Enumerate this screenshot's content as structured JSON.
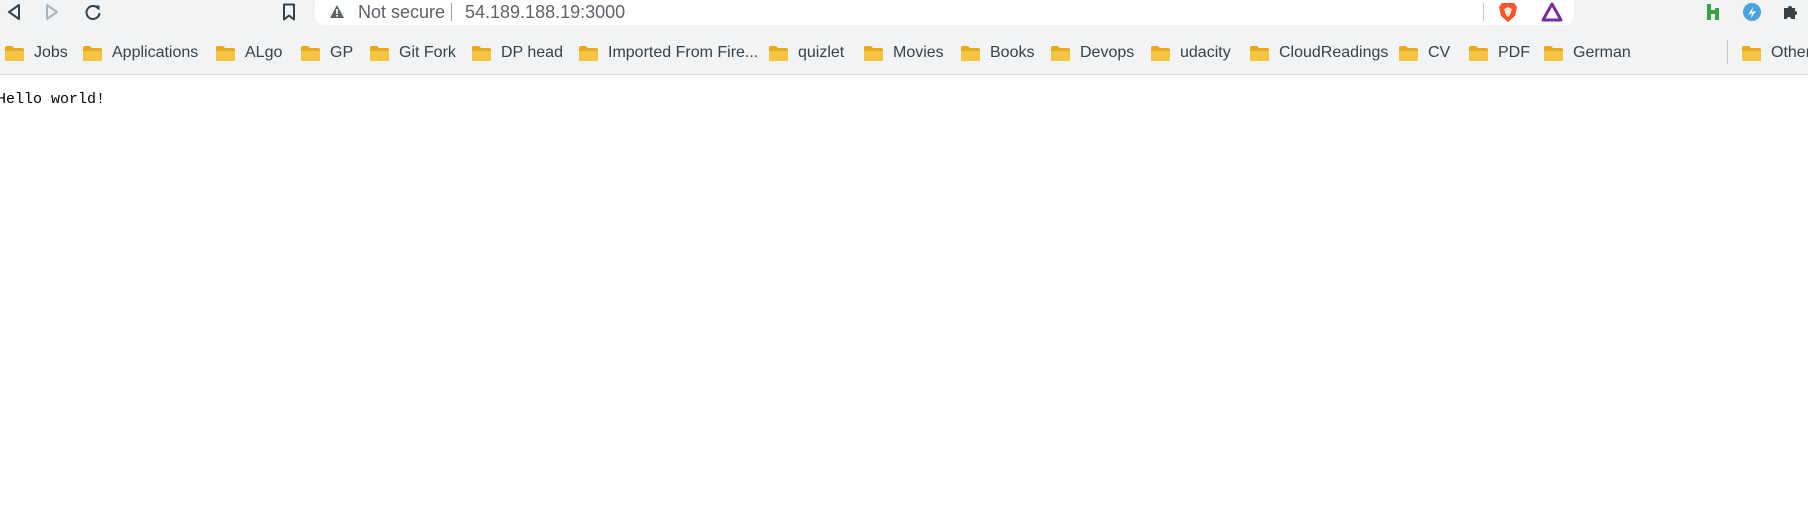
{
  "omnibox": {
    "security_status": "Not secure",
    "url": "54.189.188.19:3000"
  },
  "toolbar": {
    "icons": [
      "back-icon",
      "forward-icon",
      "reload-icon",
      "bookmark-icon",
      "warning-icon"
    ],
    "extensions": [
      "brave-icon",
      "triangle-extension-icon",
      "green-extension-icon",
      "blue-extension-icon",
      "puzzle-extensions-icon"
    ]
  },
  "bookmarks": {
    "items": [
      {
        "label": "Jobs"
      },
      {
        "label": "Applications"
      },
      {
        "label": "ALgo"
      },
      {
        "label": "GP"
      },
      {
        "label": "Git Fork"
      },
      {
        "label": "DP head"
      },
      {
        "label": "Imported From Fire..."
      },
      {
        "label": "quizlet"
      },
      {
        "label": "Movies"
      },
      {
        "label": "Books"
      },
      {
        "label": "Devops"
      },
      {
        "label": "udacity"
      },
      {
        "label": "CloudReadings"
      },
      {
        "label": "CV"
      },
      {
        "label": "PDF"
      },
      {
        "label": "German"
      }
    ],
    "other": {
      "label": "Other"
    }
  },
  "page": {
    "content": "Hello world!"
  },
  "colors": {
    "toolbar_bg": "#f1f3f4",
    "folder": "#f6c445",
    "brave": "#fb542b",
    "text": "#3c4043"
  }
}
